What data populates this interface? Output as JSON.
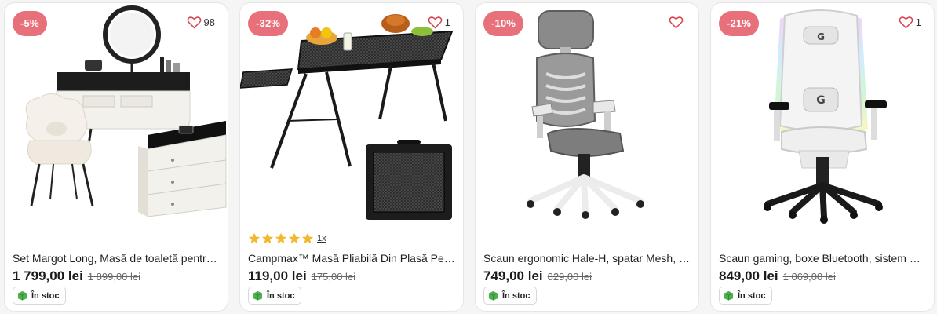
{
  "colors": {
    "badge": "#e8707a",
    "heart": "#d9434f",
    "star": "#f2b92c",
    "stock_icon": "#4caf50"
  },
  "products": [
    {
      "badge": "-5%",
      "favorites": "98",
      "image_icon": "vanity-table-set-image",
      "title": "Set Margot Long, Masă de toaletă pentru dormitor",
      "price": "1 799,00 lei",
      "old_price": "1 899,00 lei",
      "stock": "În stoc"
    },
    {
      "badge": "-32%",
      "favorites": "1",
      "image_icon": "folding-table-image",
      "rating_stars": 5,
      "rating_count": "1x",
      "title": "Campmax™ Masă Pliabilă Din Plasă Pentru Camping",
      "price": "119,00 lei",
      "old_price": "175,00 lei",
      "stock": "În stoc"
    },
    {
      "badge": "-10%",
      "favorites": "",
      "image_icon": "ergonomic-chair-image",
      "title": "Scaun ergonomic Hale-H, spatar Mesh, tetieră reglabilă",
      "price": "749,00 lei",
      "old_price": "829,00 lei",
      "stock": "În stoc"
    },
    {
      "badge": "-21%",
      "favorites": "1",
      "image_icon": "gaming-chair-image",
      "title": "Scaun gaming, boxe Bluetooth, sistem RGB, suport picioare",
      "price": "849,00 lei",
      "old_price": "1 069,00 lei",
      "stock": "În stoc"
    }
  ]
}
